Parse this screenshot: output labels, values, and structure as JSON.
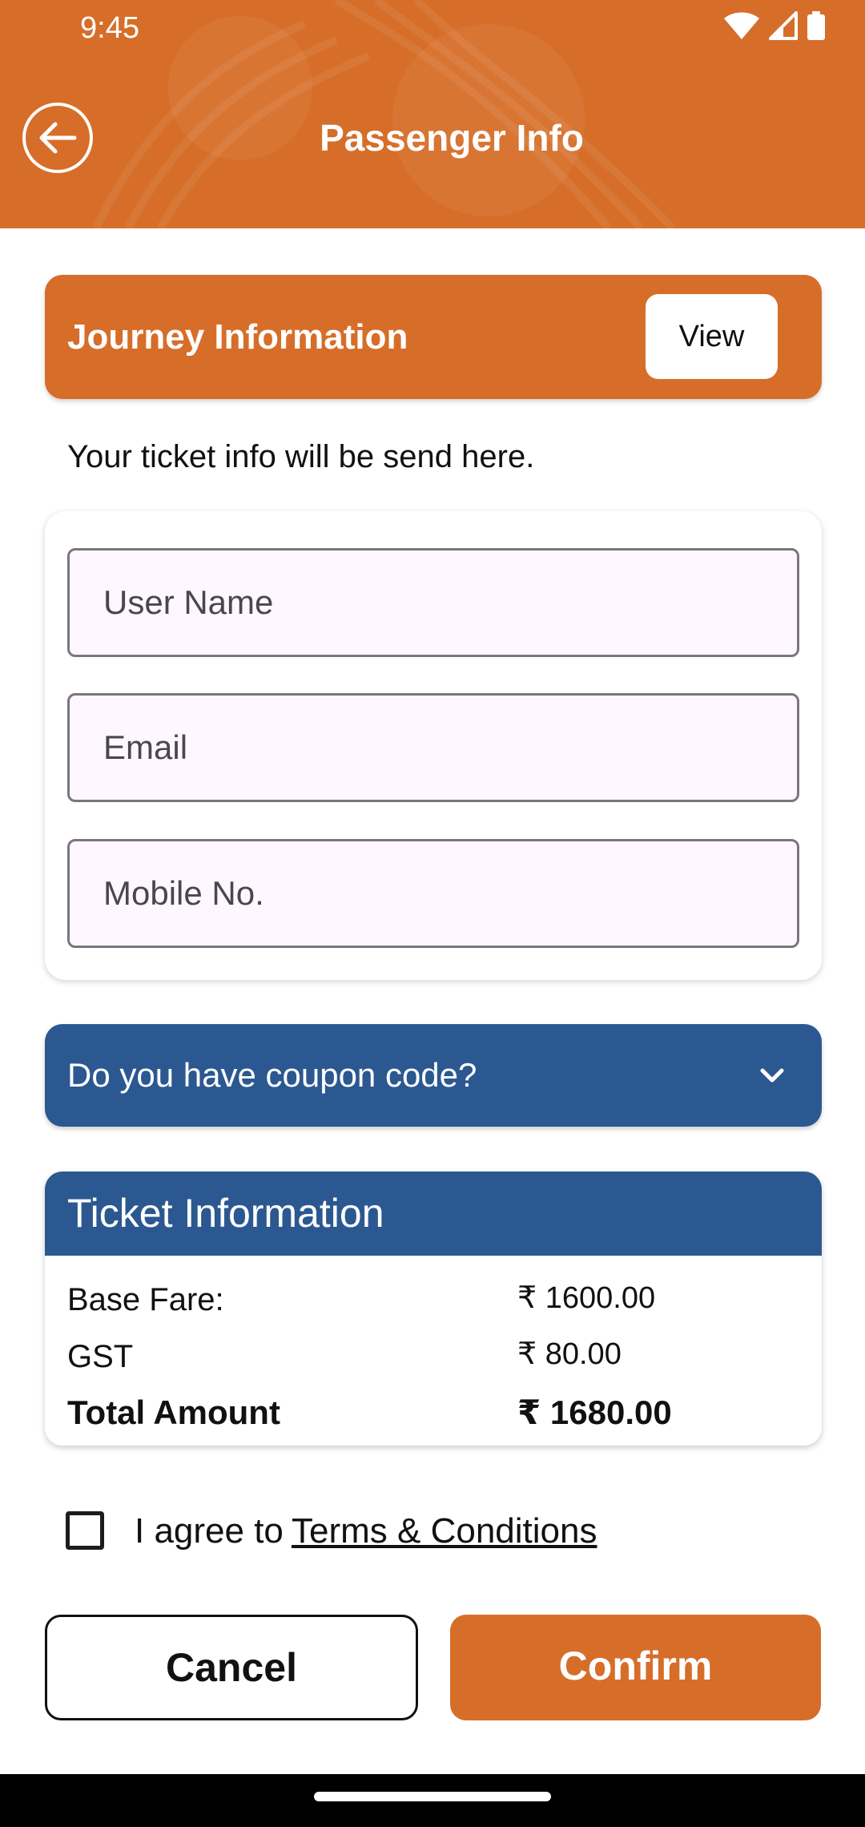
{
  "status_bar": {
    "time": "9:45",
    "icons": [
      "wifi-icon",
      "signal-icon",
      "battery-icon"
    ]
  },
  "header": {
    "title": "Passenger Info",
    "back_icon": "arrow-left-icon",
    "background_color": "#d66e29"
  },
  "journey": {
    "title": "Journey Information",
    "view_label": "View"
  },
  "ticket_note": "Your ticket info will be send here.",
  "form": {
    "username_placeholder": "User Name",
    "email_placeholder": "Email",
    "mobile_placeholder": "Mobile No."
  },
  "coupon": {
    "label": "Do you have coupon code?",
    "icon": "chevron-down-icon",
    "color": "#2c5891"
  },
  "ticket_info": {
    "title": "Ticket Information",
    "rows": [
      {
        "label": "Base Fare:",
        "value": "₹ 1600.00"
      },
      {
        "label": "GST",
        "value": "₹ 80.00"
      },
      {
        "label": "Total Amount",
        "value": "₹ 1680.00"
      }
    ]
  },
  "terms": {
    "checked": false,
    "prefix": "I agree to",
    "link": "Terms & Conditions"
  },
  "actions": {
    "cancel_label": "Cancel",
    "confirm_label": "Confirm"
  }
}
